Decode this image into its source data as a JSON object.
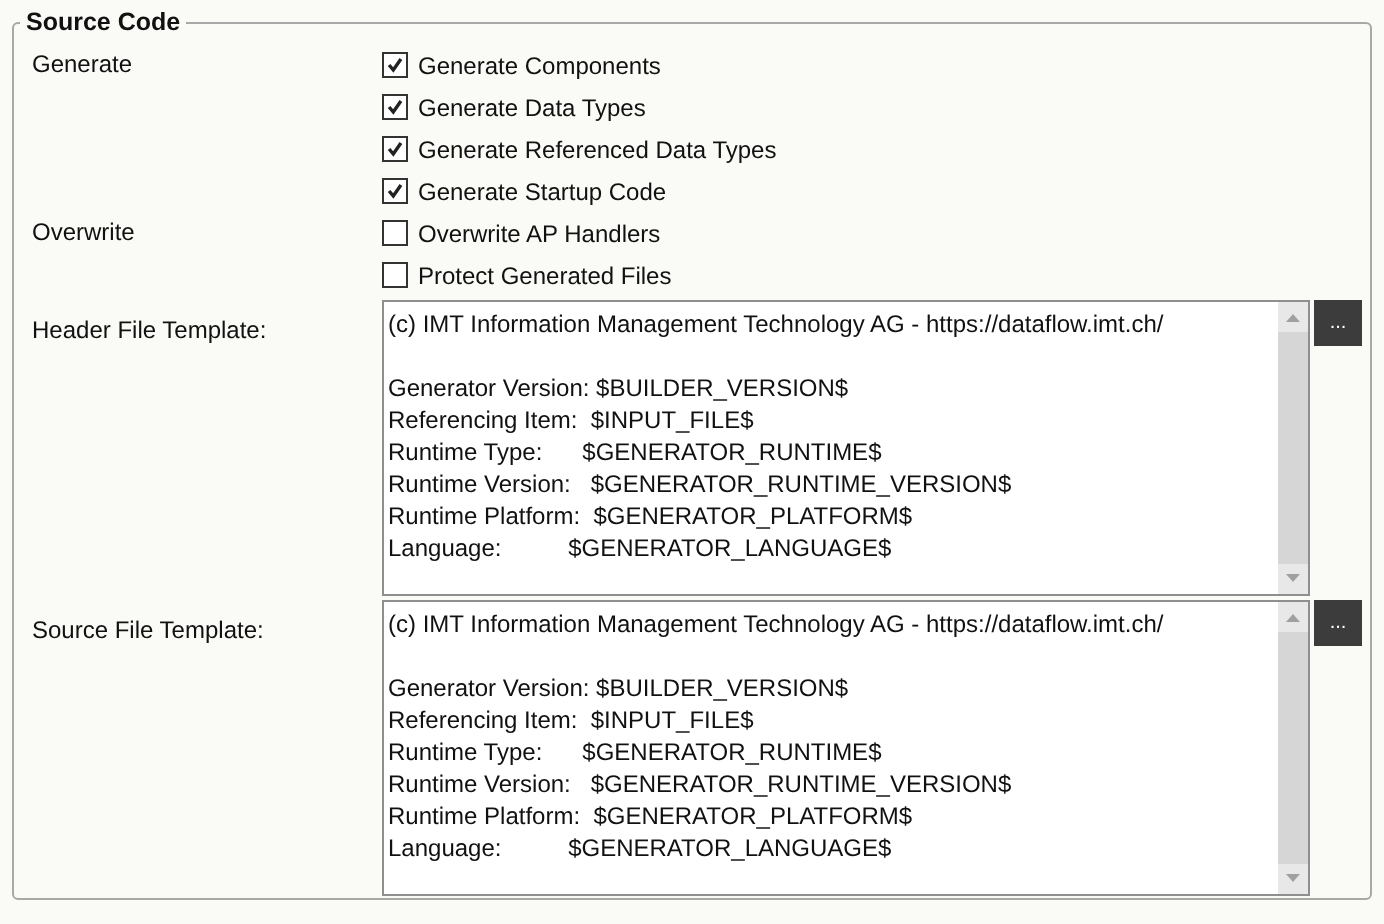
{
  "group": {
    "title": "Source Code"
  },
  "option_groups": [
    {
      "label": "Generate",
      "options": [
        {
          "label": "Generate Components",
          "checked": true
        },
        {
          "label": "Generate Data Types",
          "checked": true
        },
        {
          "label": "Generate Referenced Data Types",
          "checked": true
        },
        {
          "label": "Generate Startup Code",
          "checked": true
        }
      ]
    },
    {
      "label": "Overwrite",
      "options": [
        {
          "label": "Overwrite AP Handlers",
          "checked": false
        },
        {
          "label": "Protect Generated Files",
          "checked": false
        }
      ]
    }
  ],
  "templates": [
    {
      "label": "Header File Template:",
      "button": "...",
      "paragraphs": [
        [
          "(c) IMT Information Management Technology AG - https://dataflow.imt.ch/"
        ],
        [
          "Generator Version: $BUILDER_VERSION$",
          "Referencing Item:  $INPUT_FILE$",
          "Runtime Type:      $GENERATOR_RUNTIME$",
          "Runtime Version:   $GENERATOR_RUNTIME_VERSION$",
          "Runtime Platform:  $GENERATOR_PLATFORM$",
          "Language:          $GENERATOR_LANGUAGE$"
        ]
      ]
    },
    {
      "label": "Source File Template:",
      "button": "...",
      "paragraphs": [
        [
          "(c) IMT Information Management Technology AG - https://dataflow.imt.ch/"
        ],
        [
          "Generator Version: $BUILDER_VERSION$",
          "Referencing Item:  $INPUT_FILE$",
          "Runtime Type:      $GENERATOR_RUNTIME$",
          "Runtime Version:   $GENERATOR_RUNTIME_VERSION$",
          "Runtime Platform:  $GENERATOR_PLATFORM$",
          "Language:          $GENERATOR_LANGUAGE$"
        ]
      ]
    }
  ]
}
